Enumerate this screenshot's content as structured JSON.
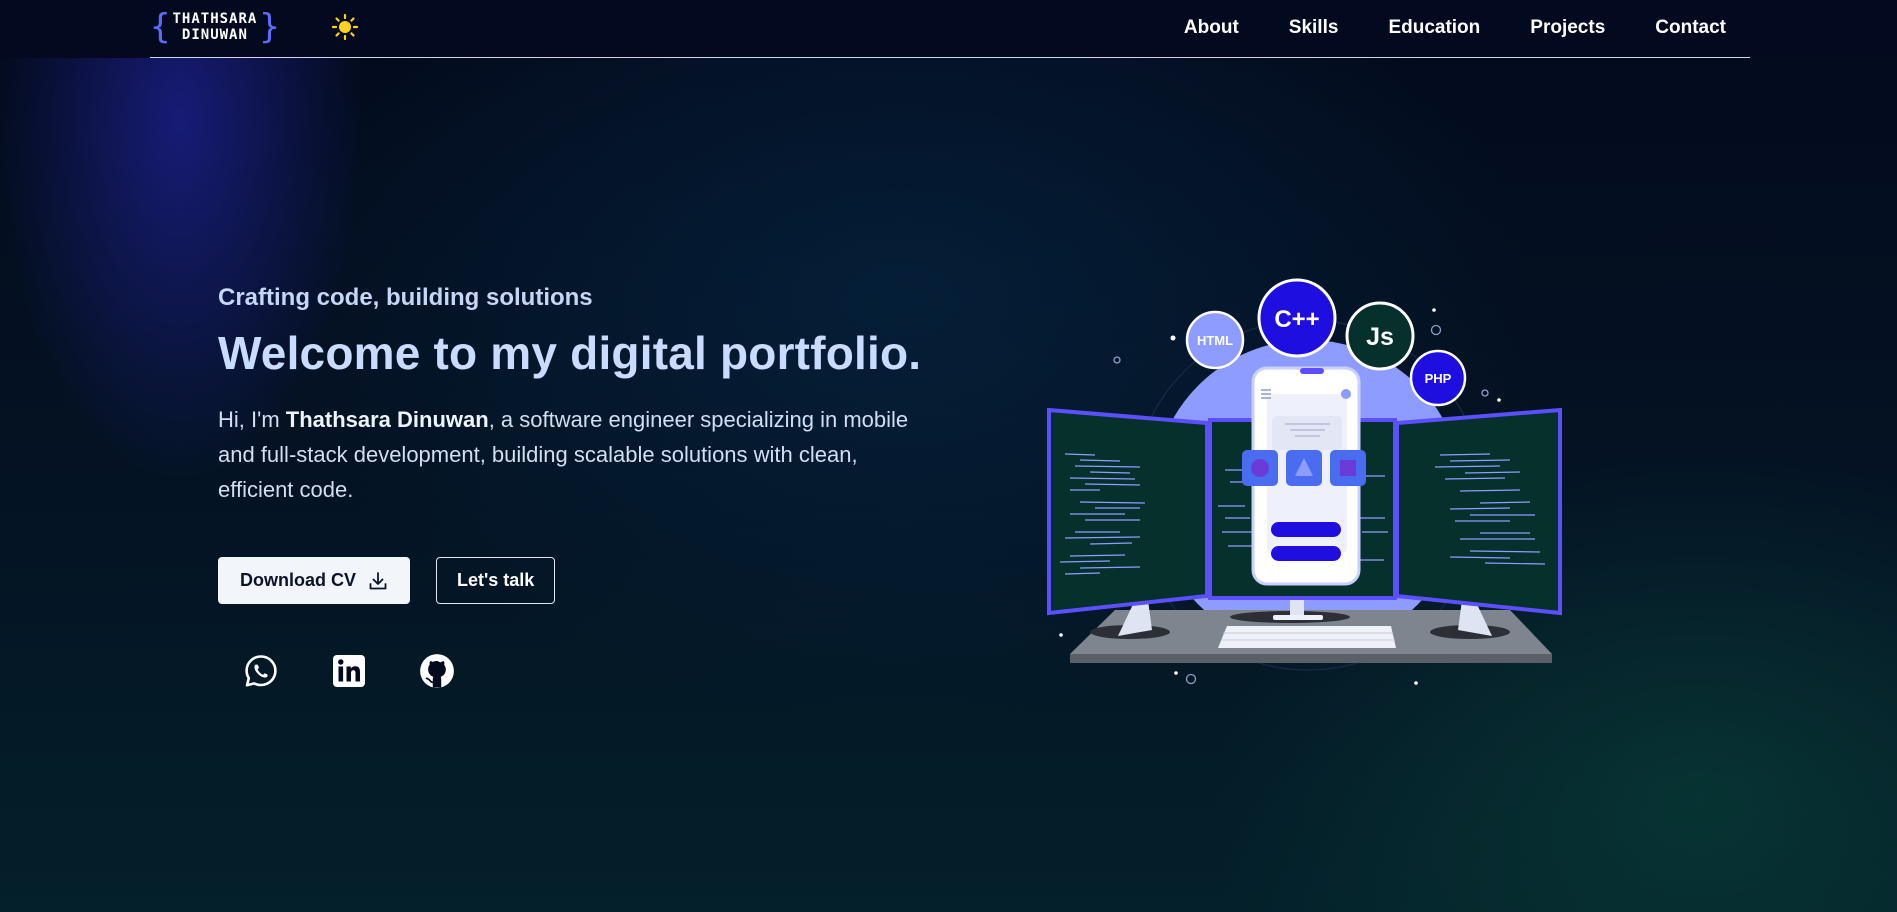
{
  "logo": {
    "line1": "THATHSARA",
    "line2": "DINUWAN",
    "brace_open": "{",
    "brace_close": "}"
  },
  "theme_toggle": {
    "icon": "sun-icon"
  },
  "nav": {
    "items": [
      "About",
      "Skills",
      "Education",
      "Projects",
      "Contact"
    ]
  },
  "hero": {
    "tagline": "Crafting code, building solutions",
    "headline": "Welcome to my digital portfolio.",
    "intro_prefix": "Hi, I'm ",
    "intro_name": "Thathsara Dinuwan",
    "intro_suffix": ", a software engineer specializing in mobile and full-stack development, building scalable solutions with clean, efficient code."
  },
  "buttons": {
    "download_cv": "Download CV",
    "lets_talk": "Let's talk"
  },
  "socials": [
    "whatsapp-icon",
    "linkedin-icon",
    "github-icon"
  ],
  "illustration": {
    "badges": [
      "HTML",
      "C++",
      "Js",
      "PHP"
    ],
    "colors": {
      "accent": "#5b6cff",
      "badge_dark": "#1f0ee0",
      "screen": "#06302c",
      "halo": "#8e9bff"
    }
  },
  "colors": {
    "background": "#041424",
    "topbar": "#030a1f",
    "text_primary": "#c9dcff"
  }
}
